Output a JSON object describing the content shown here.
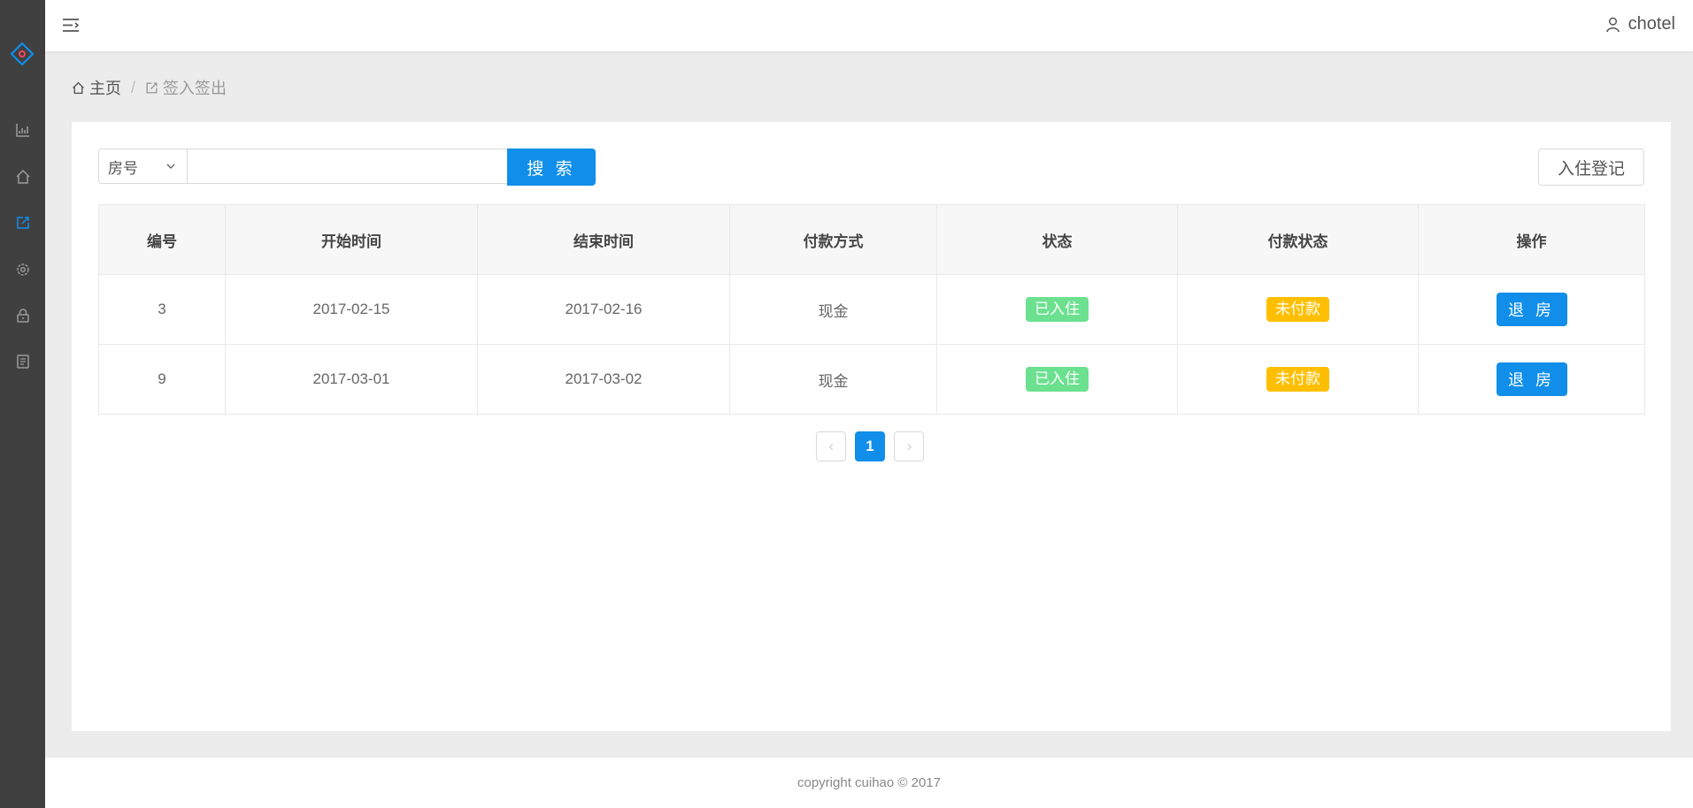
{
  "topbar": {
    "username": "chotel"
  },
  "breadcrumb": {
    "home": "主页",
    "current": "签入签出"
  },
  "search": {
    "select_value": "房号",
    "input_value": "",
    "button_label": "搜 索"
  },
  "checkin_button": "入住登记",
  "table": {
    "columns": [
      "编号",
      "开始时间",
      "结束时间",
      "付款方式",
      "状态",
      "付款状态",
      "操作"
    ],
    "rows": [
      {
        "id": "3",
        "start": "2017-02-15",
        "end": "2017-02-16",
        "payment_method": "现金",
        "status": "已入住",
        "payment_status": "未付款",
        "action": "退 房"
      },
      {
        "id": "9",
        "start": "2017-03-01",
        "end": "2017-03-02",
        "payment_method": "现金",
        "status": "已入住",
        "payment_status": "未付款",
        "action": "退 房"
      }
    ]
  },
  "pagination": {
    "current": "1"
  },
  "footer": "copyright cuihao © 2017",
  "colors": {
    "primary": "#108ee9",
    "sidebar": "#404040",
    "tag_green": "#6be08f",
    "tag_yellow": "#ffbf00"
  },
  "icons": [
    "logo-icon",
    "chart-icon",
    "home-icon",
    "signin-icon",
    "gear-icon",
    "lock-icon",
    "report-icon",
    "menu-toggle-icon",
    "user-icon"
  ]
}
